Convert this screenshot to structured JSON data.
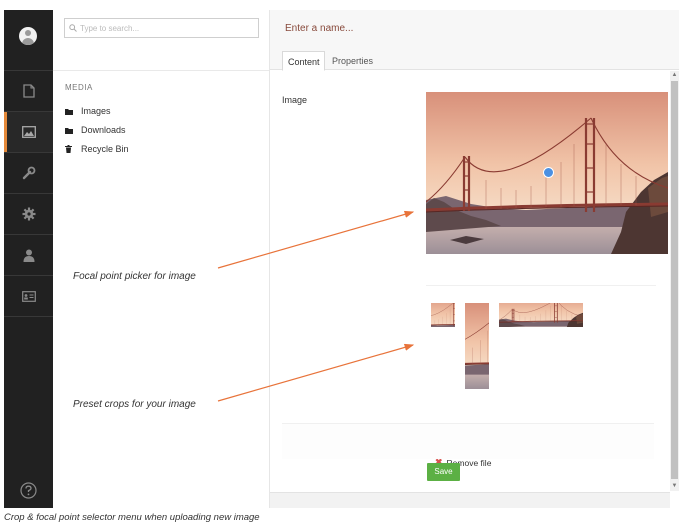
{
  "rail": {
    "icons": [
      "avatar-icon",
      "document-icon",
      "media-icon",
      "wrench-icon",
      "gear-icon",
      "user-icon",
      "id-card-icon",
      "help-icon"
    ],
    "active": "media-icon",
    "accent_color": "#e4893a"
  },
  "tree": {
    "search_placeholder": "Type to search...",
    "section_title": "MEDIA",
    "items": [
      {
        "label": "Images",
        "icon": "folder-icon"
      },
      {
        "label": "Downloads",
        "icon": "folder-icon"
      },
      {
        "label": "Recycle Bin",
        "icon": "trash-icon"
      }
    ]
  },
  "editor": {
    "name_placeholder": "Enter a name...",
    "tabs": [
      {
        "label": "Content",
        "active": true
      },
      {
        "label": "Properties",
        "active": false
      }
    ],
    "property_label": "Image",
    "remove_label": "Remove file",
    "save_label": "Save",
    "save_color": "#5cb044",
    "focal_color": "#4a90e2"
  },
  "annotations": {
    "focal": "Focal point picker for image",
    "crops": "Preset crops for your image",
    "arrow_color": "#e8733a"
  },
  "caption": "Crop & focal point selector menu when uploading new image"
}
